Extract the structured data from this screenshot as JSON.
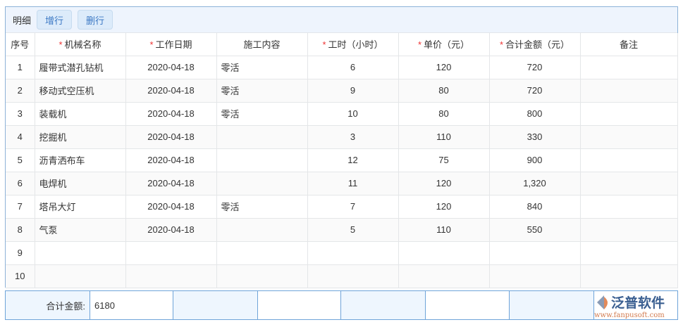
{
  "toolbar": {
    "title": "明细",
    "add_row": "增行",
    "delete_row": "删行"
  },
  "columns": [
    {
      "label": "序号",
      "required": false
    },
    {
      "label": "机械名称",
      "required": true
    },
    {
      "label": "工作日期",
      "required": true
    },
    {
      "label": "施工内容",
      "required": false
    },
    {
      "label": "工时（小时）",
      "required": true
    },
    {
      "label": "单价（元）",
      "required": true
    },
    {
      "label": "合计金额（元）",
      "required": true
    },
    {
      "label": "备注",
      "required": false
    }
  ],
  "rows": [
    [
      "1",
      "履带式潜孔钻机",
      "2020-04-18",
      "零活",
      "6",
      "120",
      "720",
      ""
    ],
    [
      "2",
      "移动式空压机",
      "2020-04-18",
      "零活",
      "9",
      "80",
      "720",
      ""
    ],
    [
      "3",
      "装载机",
      "2020-04-18",
      "零活",
      "10",
      "80",
      "800",
      ""
    ],
    [
      "4",
      "挖掘机",
      "2020-04-18",
      "",
      "3",
      "110",
      "330",
      ""
    ],
    [
      "5",
      "沥青洒布车",
      "2020-04-18",
      "",
      "12",
      "75",
      "900",
      ""
    ],
    [
      "6",
      "电焊机",
      "2020-04-18",
      "",
      "11",
      "120",
      "1,320",
      ""
    ],
    [
      "7",
      "塔吊大灯",
      "2020-04-18",
      "零活",
      "7",
      "120",
      "840",
      ""
    ],
    [
      "8",
      "气泵",
      "2020-04-18",
      "",
      "5",
      "110",
      "550",
      ""
    ],
    [
      "9",
      "",
      "",
      "",
      "",
      "",
      "",
      ""
    ],
    [
      "10",
      "",
      "",
      "",
      "",
      "",
      "",
      ""
    ]
  ],
  "footer": {
    "total_label": "合计金额:",
    "total_value": "6180"
  },
  "logo": {
    "name": "泛普软件",
    "url": "www.fanpusoft.com"
  }
}
